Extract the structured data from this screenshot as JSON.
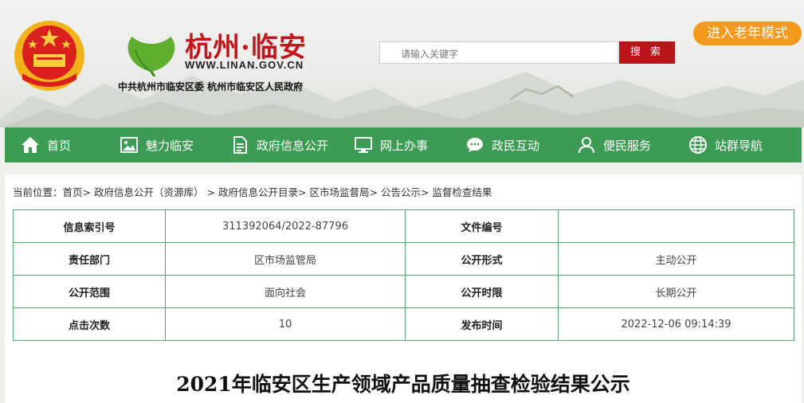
{
  "header": {
    "site_title": "杭州·临安",
    "site_url": "WWW.LINAN.GOV.CN",
    "site_subtitle": "中共杭州市临安区委  杭州市临安区人民政府",
    "search_placeholder": "请输入关键字",
    "search_button": "搜 索",
    "elder_mode_button": "进入老年模式"
  },
  "nav": {
    "items": [
      {
        "label": "首页",
        "icon": "home-icon"
      },
      {
        "label": "魅力临安",
        "icon": "picture-icon"
      },
      {
        "label": "政府信息公开",
        "icon": "document-icon"
      },
      {
        "label": "网上办事",
        "icon": "monitor-icon"
      },
      {
        "label": "政民互动",
        "icon": "chat-icon"
      },
      {
        "label": "便民服务",
        "icon": "user-icon"
      },
      {
        "label": "站群导航",
        "icon": "globe-icon"
      }
    ]
  },
  "breadcrumb": {
    "prefix": "当前位置：",
    "items": [
      "首页",
      "政府信息公开（资源库）",
      "政府信息公开目录",
      "区市场监督局",
      "公告公示",
      "监督检查结果"
    ],
    "separator": ">"
  },
  "info_table": {
    "rows": [
      {
        "label1": "信息索引号",
        "value1": "311392064/2022-87796",
        "label2": "文件编号",
        "value2": ""
      },
      {
        "label1": "责任部门",
        "value1": "区市场监管局",
        "label2": "公开形式",
        "value2": "主动公开"
      },
      {
        "label1": "公开范围",
        "value1": "面向社会",
        "label2": "公开时限",
        "value2": "长期公开"
      },
      {
        "label1": "点击次数",
        "value1": "10",
        "label2": "发布时间",
        "value2": "2022-12-06 09:14:39"
      }
    ]
  },
  "article": {
    "title": "2021年临安区生产领域产品质量抽查检验结果公示"
  },
  "colors": {
    "nav_green": "#3c9c54",
    "table_border": "#5aa36e",
    "search_red": "#b91519",
    "elder_orange": "#f39a1e",
    "title_red": "#c2161a"
  }
}
